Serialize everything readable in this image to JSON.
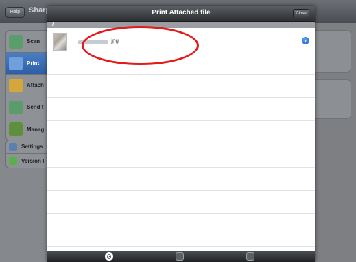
{
  "background": {
    "help_label": "Help",
    "brand": "Sharp",
    "menu": [
      {
        "label": "Scan",
        "icon": "scanner-icon",
        "color": "#5a9d6a"
      },
      {
        "label": "Print",
        "icon": "printer-icon",
        "color": "#4a7fc4"
      },
      {
        "label": "Attach",
        "icon": "envelope-icon",
        "color": "#d5a63a"
      },
      {
        "label": "Send t",
        "icon": "send-icon",
        "color": "#5a9d6a"
      },
      {
        "label": "Manag",
        "icon": "manage-icon",
        "color": "#5e8f3a"
      }
    ],
    "menu_labels_visible": [
      "Scan",
      "Print",
      "Attach",
      "Send t",
      "Manag"
    ],
    "secondary_menu": [
      {
        "label": "Settings",
        "icon": "gear-icon",
        "color": "#5a7fb0"
      },
      {
        "label": "Version I",
        "icon": "info-icon",
        "color": "#5ab04a"
      }
    ]
  },
  "modal": {
    "title": "Print Attached file",
    "close_label": "Close",
    "path": "/",
    "files": [
      {
        "name": ".jpg",
        "icon": "image-thumbnail"
      }
    ],
    "empty_rows": 9
  },
  "toolbar": {
    "buttons": [
      {
        "icon": "compass-icon",
        "glyph": "⊘"
      },
      {
        "icon": "print-icon"
      },
      {
        "icon": "folder-icon"
      }
    ]
  },
  "colors": {
    "accent": "#1f63c8",
    "highlight": "#e31b1b"
  }
}
